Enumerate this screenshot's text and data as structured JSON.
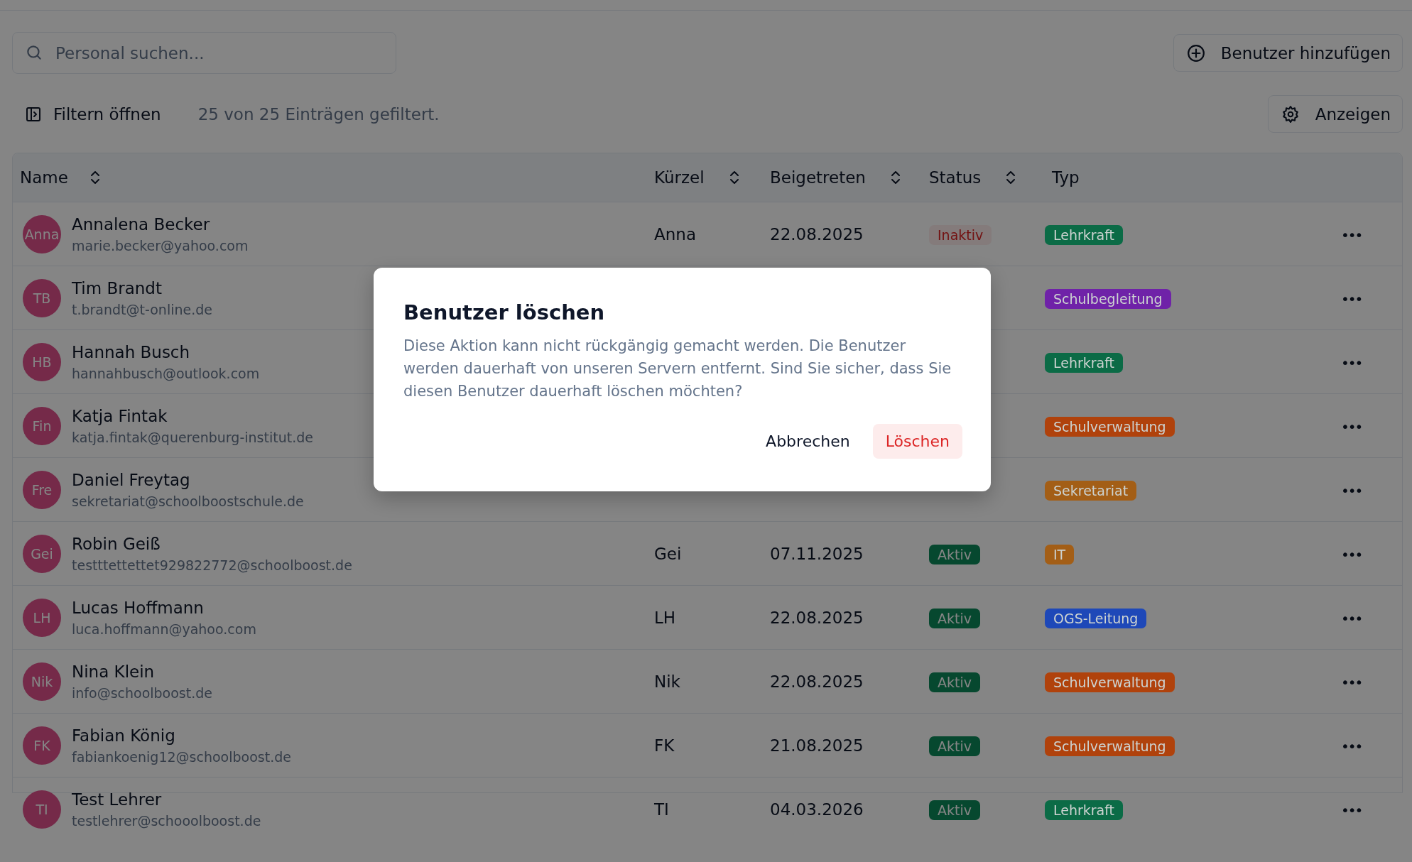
{
  "search": {
    "placeholder": "Personal suchen..."
  },
  "add_button": {
    "label": "Benutzer hinzufügen"
  },
  "filter_button": {
    "label": "Filtern öffnen"
  },
  "filter_summary": "25 von 25 Einträgen gefiltert.",
  "view_button": {
    "label": "Anzeigen"
  },
  "table": {
    "columns": [
      {
        "label": "Name",
        "sortable": true
      },
      {
        "label": "Kürzel",
        "sortable": true
      },
      {
        "label": "Beigetreten",
        "sortable": true
      },
      {
        "label": "Status",
        "sortable": true
      },
      {
        "label": "Typ",
        "sortable": false
      }
    ],
    "rows": [
      {
        "initials": "Anna",
        "name": "Annalena Becker",
        "email": "marie.becker@yahoo.com",
        "short": "Anna",
        "joined": "22.08.2025",
        "status": {
          "label": "Inaktiv",
          "active": false
        },
        "type": {
          "label": "Lehrkraft",
          "color": "#0b6b46"
        },
        "menu": "•••"
      },
      {
        "initials": "TB",
        "name": "Tim Brandt",
        "email": "t.brandt@t-online.de",
        "type": {
          "label": "Schulbegleitung",
          "color": "#6f22a8"
        },
        "menu": "•••"
      },
      {
        "initials": "HB",
        "name": "Hannah Busch",
        "email": "hannahbusch@outlook.com",
        "type": {
          "label": "Lehrkraft",
          "color": "#0b6b46"
        },
        "menu": "•••"
      },
      {
        "initials": "Fin",
        "name": "Katja Fintak",
        "email": "katja.fintak@querenburg-institut.de",
        "type": {
          "label": "Schulverwaltung",
          "color": "#b0420c"
        },
        "menu": "•••"
      },
      {
        "initials": "Fre",
        "name": "Daniel Freytag",
        "email": "sekretariat@schoolboostschule.de",
        "type": {
          "label": "Sekretariat",
          "color": "#a35e16"
        },
        "menu": "•••"
      },
      {
        "initials": "Gei",
        "name": "Robin Geiß",
        "email": "testttettettet929822772@schoolboost.de",
        "short": "Gei",
        "joined": "07.11.2025",
        "status": {
          "label": "Aktiv",
          "active": true
        },
        "type": {
          "label": "IT",
          "color": "#a35e16"
        },
        "menu": "•••"
      },
      {
        "initials": "LH",
        "name": "Lucas Hoffmann",
        "email": "luca.hoffmann@yahoo.com",
        "short": "LH",
        "joined": "22.08.2025",
        "status": {
          "label": "Aktiv",
          "active": true
        },
        "type": {
          "label": "OGS-Leitung",
          "color": "#1e48b8"
        },
        "menu": "•••"
      },
      {
        "initials": "Nik",
        "name": "Nina Klein",
        "email": "info@schoolboost.de",
        "short": "Nik",
        "joined": "22.08.2025",
        "status": {
          "label": "Aktiv",
          "active": true
        },
        "type": {
          "label": "Schulverwaltung",
          "color": "#b0420c"
        },
        "menu": "•••"
      },
      {
        "initials": "FK",
        "name": "Fabian König",
        "email": "fabiankoenig12@schoolboost.de",
        "short": "FK",
        "joined": "21.08.2025",
        "status": {
          "label": "Aktiv",
          "active": true
        },
        "type": {
          "label": "Schulverwaltung",
          "color": "#b0420c"
        },
        "menu": "•••"
      },
      {
        "initials": "TI",
        "name": "Test Lehrer",
        "email": "testlehrer@schooolboost.de",
        "short": "TI",
        "joined": "04.03.2026",
        "status": {
          "label": "Aktiv",
          "active": true
        },
        "type": {
          "label": "Lehrkraft",
          "color": "#0b6b46"
        },
        "menu": "•••"
      }
    ]
  },
  "dialog": {
    "title": "Benutzer löschen",
    "message": "Diese Aktion kann nicht rückgängig gemacht werden. Die Benutzer werden dauerhaft von unseren Servern entfernt. Sind Sie sicher, dass Sie diesen Benutzer dauerhaft löschen möchten?",
    "buttons": [
      {
        "label": "Abbrechen",
        "kind": "cancel"
      },
      {
        "label": "Löschen",
        "kind": "destructive"
      }
    ]
  }
}
